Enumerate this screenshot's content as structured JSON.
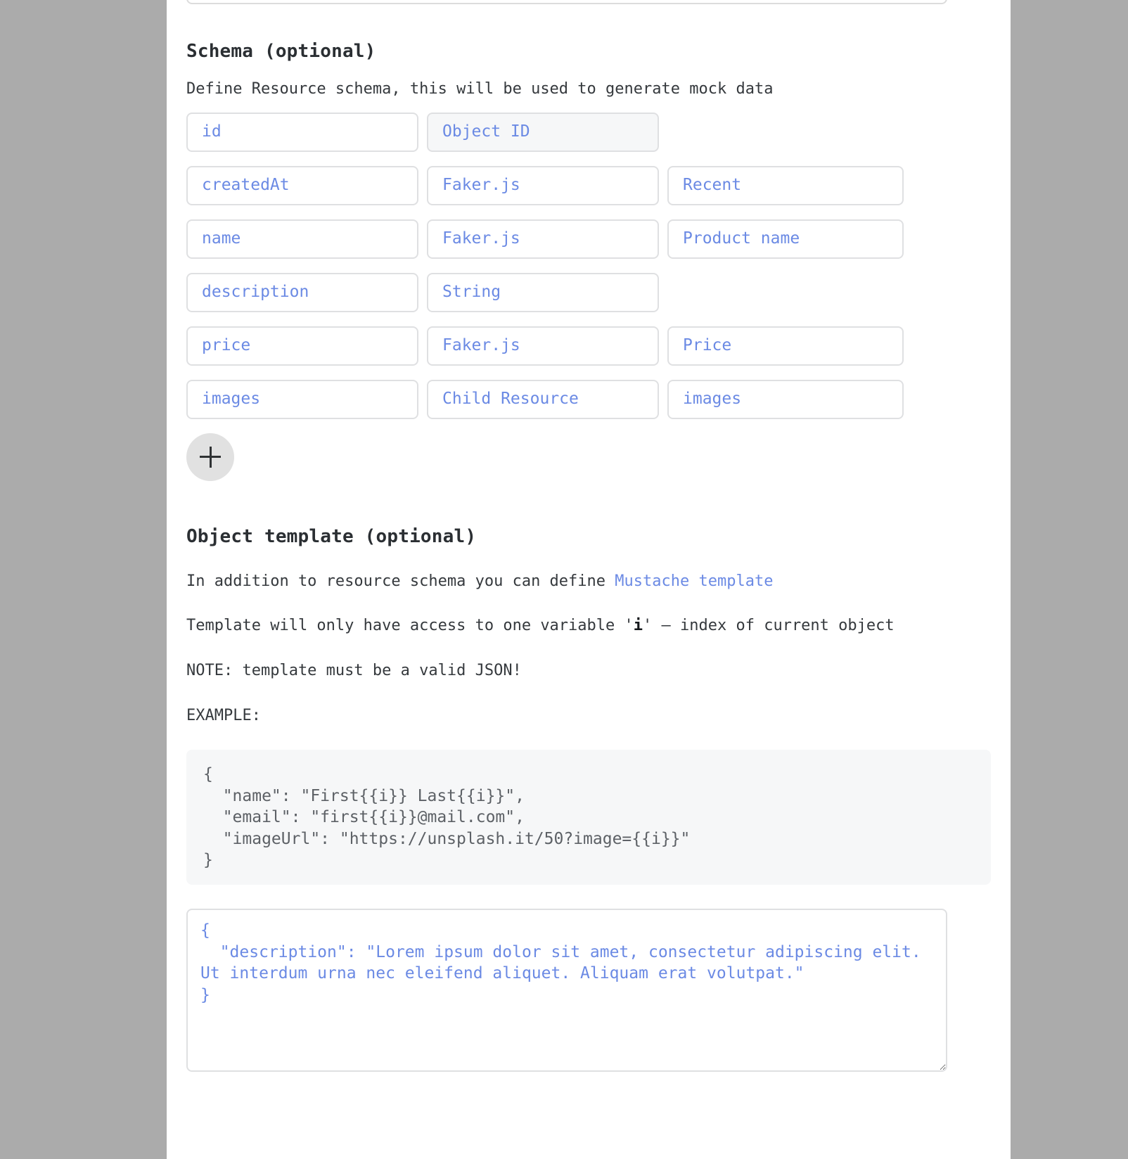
{
  "schema": {
    "heading": "Schema (optional)",
    "description": "Define Resource schema, this will be used to generate mock data",
    "rows": [
      {
        "key": "id",
        "type": "Object ID",
        "extra": "",
        "type_disabled": true,
        "has_extra": false
      },
      {
        "key": "createdAt",
        "type": "Faker.js",
        "extra": "Recent",
        "type_disabled": false,
        "has_extra": true
      },
      {
        "key": "name",
        "type": "Faker.js",
        "extra": "Product name",
        "type_disabled": false,
        "has_extra": true
      },
      {
        "key": "description",
        "type": "String",
        "extra": "",
        "type_disabled": false,
        "has_extra": false
      },
      {
        "key": "price",
        "type": "Faker.js",
        "extra": "Price",
        "type_disabled": false,
        "has_extra": true
      },
      {
        "key": "images",
        "type": "Child Resource",
        "extra": "images",
        "type_disabled": false,
        "has_extra": true
      }
    ],
    "add_row_label": "+"
  },
  "template": {
    "heading": "Object template (optional)",
    "intro_prefix": "In addition to resource schema you can define ",
    "intro_link": "Mustache template",
    "variable_line_prefix": "Template will only have access to one variable '",
    "variable_name": "i",
    "variable_line_suffix": "' – index of current object",
    "note": "NOTE: template must be a valid JSON!",
    "example_label": "EXAMPLE:",
    "example_code": "{\n  \"name\": \"First{{i}} Last{{i}}\",\n  \"email\": \"first{{i}}@mail.com\",\n  \"imageUrl\": \"https://unsplash.it/50?image={{i}}\"\n}",
    "textarea_value": "{\n  \"description\": \"Lorem ipsum dolor sit amet, consectetur adipiscing elit. Ut interdum urna nec eleifend aliquet. Aliquam erat volutpat.\"\n}",
    "textarea_placeholder": ""
  },
  "colors": {
    "accent": "#6b8ae4",
    "text": "#35393d",
    "heading": "#2b2f33",
    "field_border": "#dfe0e2",
    "code_bg": "#f6f7f8",
    "page_bg": "#ababab"
  }
}
